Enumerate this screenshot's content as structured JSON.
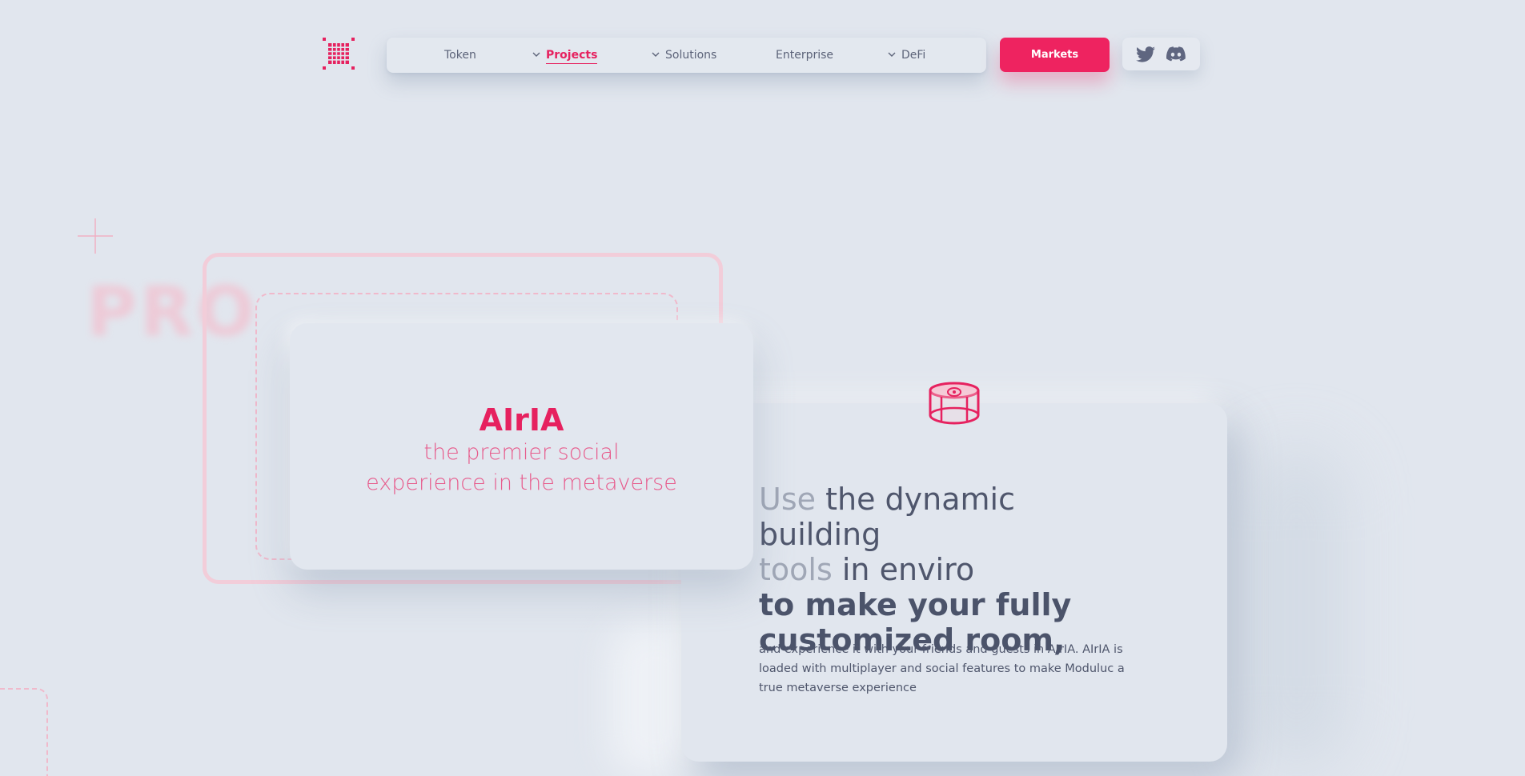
{
  "header": {
    "logo_name": "grid-logo",
    "nav": [
      {
        "label": "Token",
        "has_chevron": false,
        "active": false
      },
      {
        "label": "Projects",
        "has_chevron": true,
        "active": true
      },
      {
        "label": "Solutions",
        "has_chevron": true,
        "active": false
      },
      {
        "label": "Enterprise",
        "has_chevron": false,
        "active": false
      },
      {
        "label": "DeFi",
        "has_chevron": true,
        "active": false
      }
    ],
    "cta_label": "Markets",
    "socials": [
      "twitter-icon",
      "discord-icon"
    ]
  },
  "hero": {
    "bg_word": "PRO",
    "app_name": "AIrIA",
    "tagline_line1": "the premier social",
    "tagline_line2": "experience in the metaverse"
  },
  "feature": {
    "icon": "room-icon",
    "headline_dim1": "Use",
    "headline_rest1": " the dynamic building",
    "headline_dim2": "tools",
    "headline_rest2": " in enviro",
    "headline_bold": "to make your fully customized room,",
    "description": "and experience it with your friends and guests in AIrIA. AIrIA is loaded with multiplayer and social features to make Moduluc a true metaverse experience"
  },
  "colors": {
    "accent": "#ee2360",
    "background": "#e1e6ee",
    "text": "#4b536a"
  }
}
